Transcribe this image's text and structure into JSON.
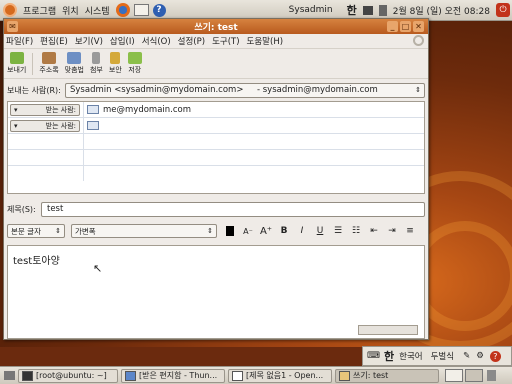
{
  "top_panel": {
    "menus": [
      "프로그램",
      "위치",
      "시스템"
    ],
    "user": "Sysadmin",
    "ime": "한",
    "datetime": "2월 8일 (일) 오전 08:28"
  },
  "window": {
    "title": "쓰기: test",
    "menus": [
      "파일(F)",
      "편집(E)",
      "보기(V)",
      "삽입(I)",
      "서식(O)",
      "설정(P)",
      "도구(T)",
      "도움말(H)"
    ],
    "toolbar": [
      {
        "label": "보내기",
        "icon": "send-icon"
      },
      {
        "label": "주소록",
        "icon": "address-book-icon"
      },
      {
        "label": "맞춤법",
        "icon": "spelling-icon"
      },
      {
        "label": "첨부",
        "icon": "attach-icon"
      },
      {
        "label": "보안",
        "icon": "lock-icon"
      },
      {
        "label": "저장",
        "icon": "save-icon"
      }
    ],
    "from_label": "보내는 사람(R):",
    "from_value": "Sysadmin <sysadmin@mydomain.com>     - sysadmin@mydomain.com",
    "recipients": [
      {
        "type": "받는 사람:",
        "address": "me@mydomain.com"
      },
      {
        "type": "받는 사람:",
        "address": ""
      }
    ],
    "subject_label": "제목(S):",
    "subject_value": "test",
    "format": {
      "paragraph": "본문 글자",
      "font": "가변폭",
      "buttons": [
        "B",
        "I",
        "U"
      ]
    },
    "body_text": "test토아양"
  },
  "tray": {
    "ime": "한",
    "lang": "한국어",
    "mode": "두벌식"
  },
  "taskbar": [
    {
      "label": "[root@ubuntu: ~]",
      "active": false
    },
    {
      "label": "[받은 편지함 - Thun...",
      "active": false
    },
    {
      "label": "[제목 없음1 - Open...",
      "active": false
    },
    {
      "label": "쓰기: test",
      "active": true
    }
  ],
  "colors": {
    "title_bar": "#c56a2c",
    "desktop": "#8a3a12",
    "panel": "#dcd7cd"
  }
}
